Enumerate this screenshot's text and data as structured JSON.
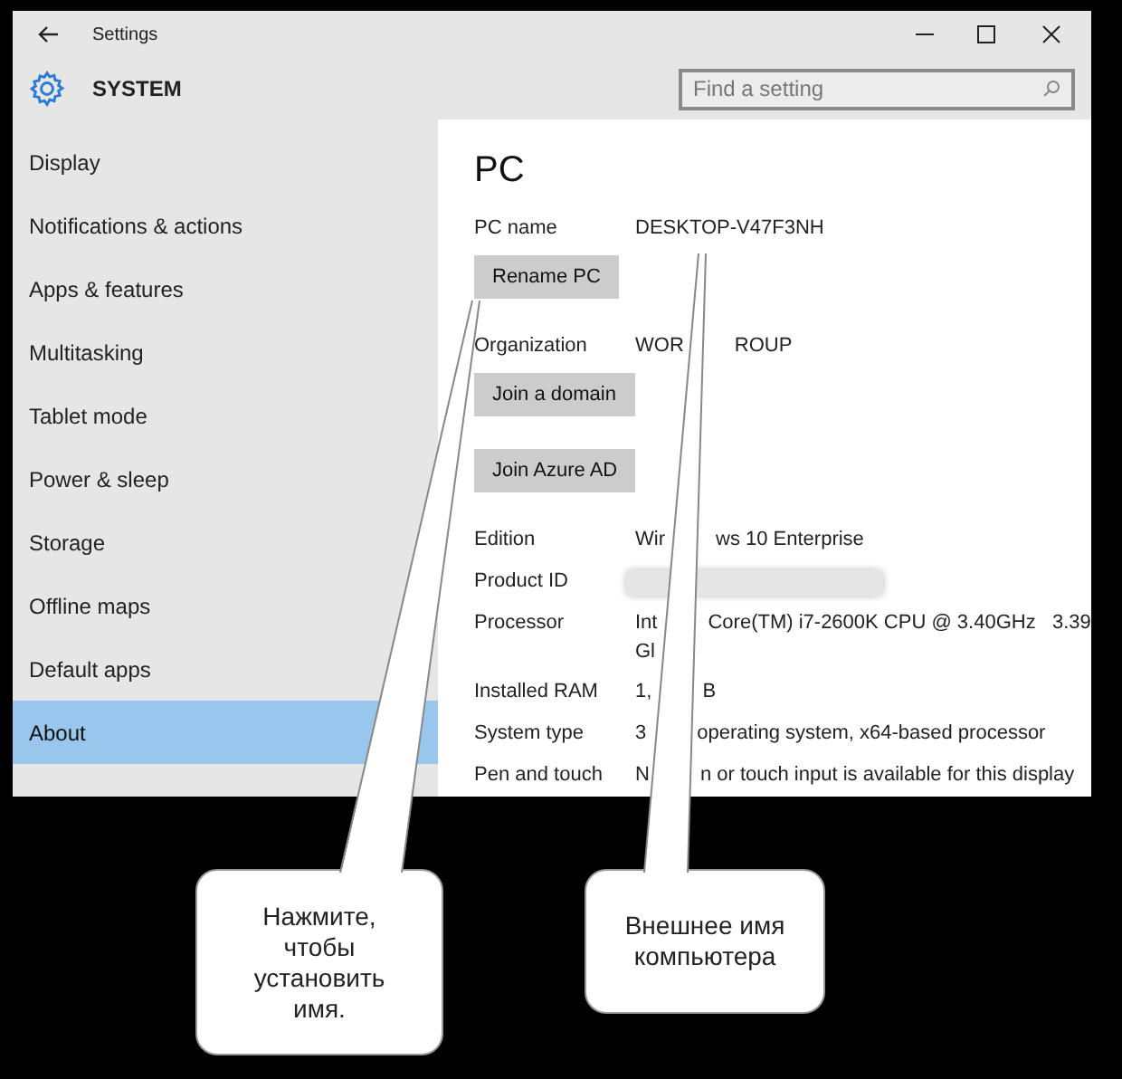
{
  "window": {
    "title": "Settings"
  },
  "header": {
    "title": "SYSTEM",
    "search": {
      "placeholder": "Find a setting"
    }
  },
  "sidebar": {
    "items": [
      {
        "label": "Display",
        "selected": false
      },
      {
        "label": "Notifications & actions",
        "selected": false
      },
      {
        "label": "Apps & features",
        "selected": false
      },
      {
        "label": "Multitasking",
        "selected": false
      },
      {
        "label": "Tablet mode",
        "selected": false
      },
      {
        "label": "Power & sleep",
        "selected": false
      },
      {
        "label": "Storage",
        "selected": false
      },
      {
        "label": "Offline maps",
        "selected": false
      },
      {
        "label": "Default apps",
        "selected": false
      },
      {
        "label": "About",
        "selected": true
      }
    ]
  },
  "content": {
    "heading": "PC",
    "sections": [
      {
        "kind": "field",
        "label": "PC name",
        "parts": [
          "DESKTOP-V47F3NH"
        ]
      },
      {
        "kind": "button",
        "label": "Rename PC"
      },
      {
        "kind": "field",
        "label": "Organization",
        "parts": [
          "WOR",
          "ROUP"
        ]
      },
      {
        "kind": "button",
        "label": "Join a domain"
      },
      {
        "kind": "button",
        "label": "Join Azure AD"
      },
      {
        "kind": "field",
        "label": "Edition",
        "parts": [
          "Wir",
          "ws 10 Enterprise"
        ]
      },
      {
        "kind": "redacted",
        "label": "Product ID"
      },
      {
        "kind": "field",
        "label": "Processor",
        "parts": [
          "Int",
          "Core(TM) i7-2600K CPU @ 3.40GHz   3.39"
        ],
        "second_line": "Gl"
      },
      {
        "kind": "field",
        "label": "Installed RAM",
        "parts": [
          "1,",
          "B"
        ]
      },
      {
        "kind": "field",
        "label": "System type",
        "parts": [
          "3",
          "operating system, x64-based processor"
        ]
      },
      {
        "kind": "field",
        "label": "Pen and touch",
        "parts": [
          "N",
          "n or touch input is available for this display"
        ]
      }
    ]
  },
  "callouts": [
    {
      "text": "Нажмите, чтобы установить имя."
    },
    {
      "text": "Внешнее имя компьютера"
    }
  ]
}
